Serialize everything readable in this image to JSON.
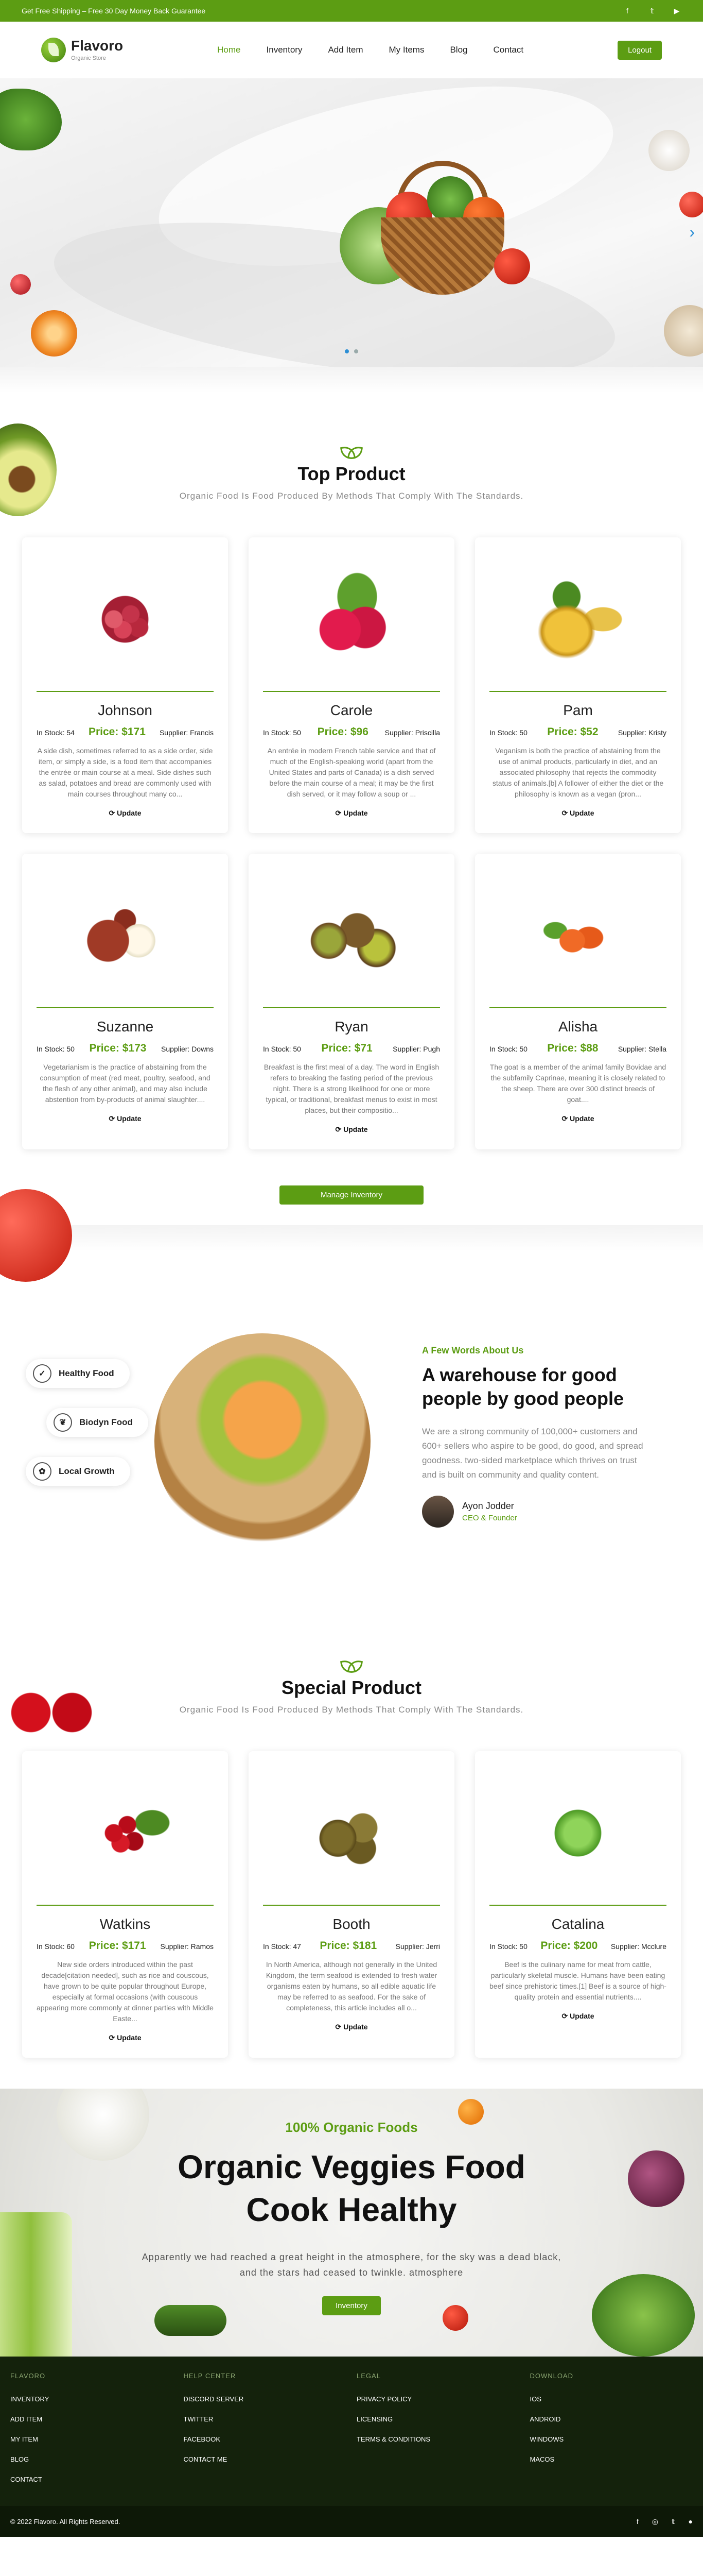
{
  "topbar": {
    "promo": "Get Free Shipping – Free 30 Day Money Back Guarantee",
    "socials": [
      {
        "icon": "facebook-icon",
        "glyph": "f"
      },
      {
        "icon": "twitter-icon",
        "glyph": "𝕥"
      },
      {
        "icon": "youtube-icon",
        "glyph": "▶"
      }
    ]
  },
  "nav": {
    "brand": "Flavoro",
    "tagline": "Organic Store",
    "links": [
      "Home",
      "Inventory",
      "Add Item",
      "My Items",
      "Blog",
      "Contact"
    ],
    "active": "Home",
    "logout": "Logout"
  },
  "hero": {
    "slides": 2,
    "active_slide": 1
  },
  "top_product": {
    "title": "Top Product",
    "subtitle": "Organic Food Is Food Produced By Methods That Comply With The Standards.",
    "products": [
      {
        "name": "Johnson",
        "stock": "In Stock: 54",
        "price": "Price: $171",
        "supplier": "Supplier: Francis",
        "desc": "A side dish, sometimes referred to as a side order, side item, or simply a side, is a food item that accompanies the entrée or main course at a meal. Side dishes such as salad, potatoes and bread are commonly used with main courses throughout many co...",
        "update": "Update"
      },
      {
        "name": "Carole",
        "stock": "In Stock: 50",
        "price": "Price: $96",
        "supplier": "Supplier: Priscilla",
        "desc": "An entrée in modern French table service and that of much of the English-speaking world (apart from the United States and parts of Canada) is a dish served before the main course of a meal; it may be the first dish served, or it may follow a soup or ...",
        "update": "Update"
      },
      {
        "name": "Pam",
        "stock": "In Stock: 50",
        "price": "Price: $52",
        "supplier": "Supplier: Kristy",
        "desc": "Veganism is both the practice of abstaining from the use of animal products, particularly in diet, and an associated philosophy that rejects the commodity status of animals.[b] A follower of either the diet or the philosophy is known as a vegan (pron...",
        "update": "Update"
      },
      {
        "name": "Suzanne",
        "stock": "In Stock: 50",
        "price": "Price: $173",
        "supplier": "Supplier: Downs",
        "desc": "Vegetarianism is the practice of abstaining from the consumption of meat (red meat, poultry, seafood, and the flesh of any other animal), and may also include abstention from by-products of animal slaughter....",
        "update": "Update"
      },
      {
        "name": "Ryan",
        "stock": "In Stock: 50",
        "price": "Price: $71",
        "supplier": "Supplier: Pugh",
        "desc": "Breakfast is the first meal of a day. The word in English refers to breaking the fasting period of the previous night. There is a strong likelihood for one or more typical, or traditional, breakfast menus to exist in most places, but their compositio...",
        "update": "Update"
      },
      {
        "name": "Alisha",
        "stock": "In Stock: 50",
        "price": "Price: $88",
        "supplier": "Supplier: Stella",
        "desc": "The goat is a member of the animal family Bovidae and the subfamily Caprinae, meaning it is closely related to the sheep. There are over 300 distinct breeds of goat....",
        "update": "Update"
      }
    ],
    "manage_button": "Manage Inventory"
  },
  "warehouse": {
    "pills": [
      "Healthy Food",
      "Biodyn Food",
      "Local Growth"
    ],
    "kicker": "A Few Words About Us",
    "title": "A warehouse for good people by good people",
    "body": "We are a strong community of 100,000+ customers and 600+ sellers who aspire to be good, do good, and spread goodness. two-sided marketplace which thrives on trust and is built on community and quality content.",
    "author": "Ayon Jodder",
    "role": "CEO & Founder"
  },
  "special_product": {
    "title": "Special Product",
    "subtitle": "Organic Food Is Food Produced By Methods That Comply With The Standards.",
    "products": [
      {
        "name": "Watkins",
        "stock": "In Stock: 60",
        "price": "Price: $171",
        "supplier": "Supplier: Ramos",
        "desc": "New side orders introduced within the past decade[citation needed], such as rice and couscous, have grown to be quite popular throughout Europe, especially at formal occasions (with couscous appearing more commonly at dinner parties with Middle Easte...",
        "update": "Update"
      },
      {
        "name": "Booth",
        "stock": "In Stock: 47",
        "price": "Price: $181",
        "supplier": "Supplier: Jerri",
        "desc": "In North America, although not generally in the United Kingdom, the term seafood is extended to fresh water organisms eaten by humans, so all edible aquatic life may be referred to as seafood. For the sake of completeness, this article includes all o...",
        "update": "Update"
      },
      {
        "name": "Catalina",
        "stock": "In Stock: 50",
        "price": "Price: $200",
        "supplier": "Supplier: Mcclure",
        "desc": "Beef is the culinary name for meat from cattle, particularly skeletal muscle. Humans have been eating beef since prehistoric times.[1] Beef is a source of high-quality protein and essential nutrients....",
        "update": "Update"
      }
    ]
  },
  "cta": {
    "kicker": "100% Organic Foods",
    "line1": "Organic Veggies Food",
    "line2": "Cook Healthy",
    "lead1": "Apparently we had reached a great height in the atmosphere, for the sky was a dead black,",
    "lead2": "and the stars had ceased to twinkle. atmosphere",
    "button": "Inventory"
  },
  "footer": {
    "columns": [
      {
        "title": "FLAVORO",
        "links": [
          "INVENTORY",
          "ADD ITEM",
          "MY ITEM",
          "BLOG",
          "CONTACT"
        ]
      },
      {
        "title": "HELP CENTER",
        "links": [
          "DISCORD SERVER",
          "TWITTER",
          "FACEBOOK",
          "CONTACT ME"
        ]
      },
      {
        "title": "LEGAL",
        "links": [
          "PRIVACY POLICY",
          "LICENSING",
          "TERMS & CONDITIONS"
        ]
      },
      {
        "title": "DOWNLOAD",
        "links": [
          "IOS",
          "ANDROID",
          "WINDOWS",
          "MACOS"
        ]
      }
    ],
    "copyright": "© 2022 Flavoro. All Rights Reserved.",
    "socials": [
      {
        "icon": "facebook-icon",
        "glyph": "f"
      },
      {
        "icon": "instagram-icon",
        "glyph": "◎"
      },
      {
        "icon": "twitter-icon",
        "glyph": "𝕥"
      },
      {
        "icon": "github-icon",
        "glyph": "●"
      }
    ]
  },
  "colors": {
    "accent": "#5c9d13",
    "footer_bg": "#14220c"
  }
}
